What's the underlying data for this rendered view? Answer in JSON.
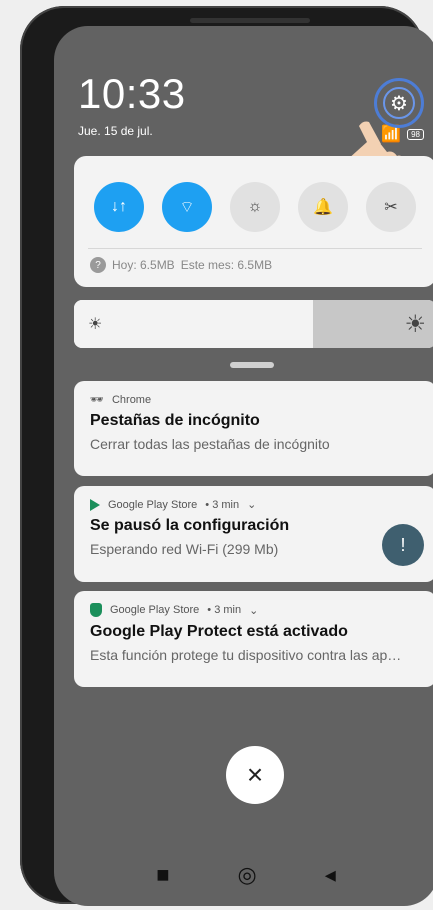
{
  "status": {
    "time": "10:33",
    "date": "Jue. 15 de jul.",
    "battery": "98"
  },
  "quick_settings": {
    "buttons": [
      {
        "icon": "data-arrows-icon",
        "active": true,
        "glyph": "↓↑"
      },
      {
        "icon": "wifi-icon",
        "active": true,
        "glyph": "⌔"
      },
      {
        "icon": "flashlight-icon",
        "active": false,
        "glyph": "☼"
      },
      {
        "icon": "bell-icon",
        "active": false,
        "glyph": "🔔"
      },
      {
        "icon": "screenshot-icon",
        "active": false,
        "glyph": "✂"
      }
    ],
    "data_usage": {
      "today": "Hoy: 6.5MB",
      "month": "Este mes: 6.5MB"
    }
  },
  "brightness": {
    "level_percent": 66
  },
  "notifications": [
    {
      "app": "Chrome",
      "title": "Pestañas de incógnito",
      "body": "Cerrar todas las pestañas de incógnito"
    },
    {
      "app": "Google Play Store",
      "time": "• 3 min",
      "title": "Se pausó la configuración",
      "body": "Esperando red Wi-Fi (299 Mb)"
    },
    {
      "app": "Google Play Store",
      "time": "• 3 min",
      "title": "Google Play Protect está activado",
      "body": "Esta función protege tu dispositivo contra las ap…"
    }
  ],
  "colors": {
    "active_blue": "#1ea0f2",
    "panel": "#f3f3f3",
    "accent_green": "#1b8f5b"
  }
}
